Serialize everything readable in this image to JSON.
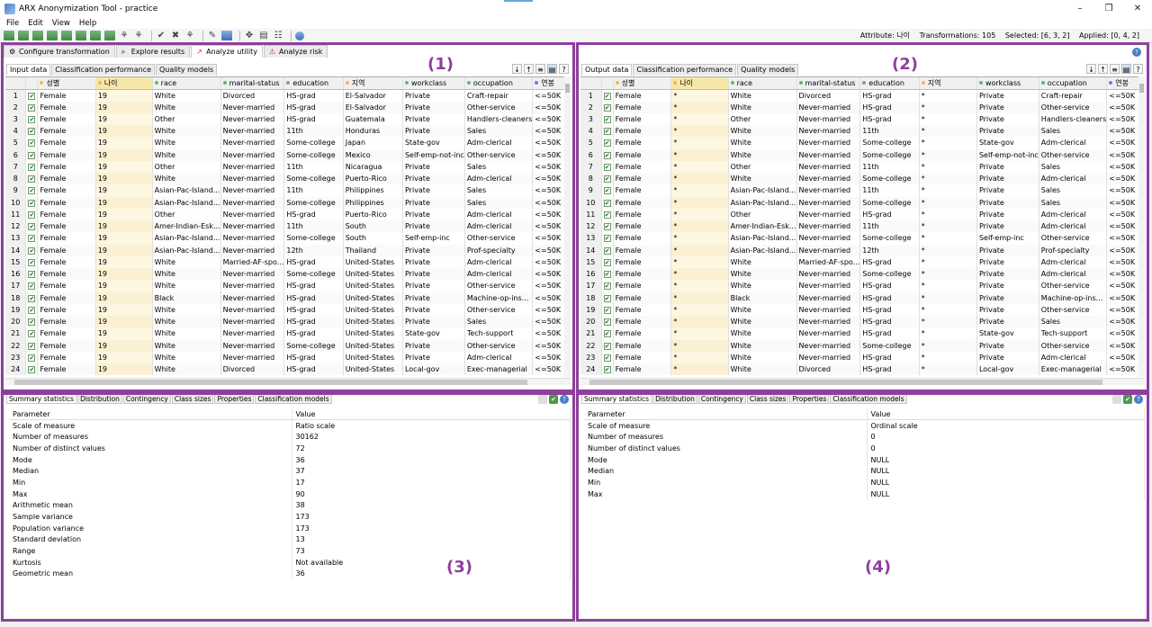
{
  "window": {
    "title": "ARX Anonymization Tool - practice",
    "controls": [
      "–",
      "❐",
      "✕"
    ]
  },
  "menu": [
    "File",
    "Edit",
    "View",
    "Help"
  ],
  "status": {
    "attribute": "Attribute: 나이",
    "transformations": "Transformations: 105",
    "selected": "Selected: [6, 3, 2]",
    "applied": "Applied: [0, 4, 2]"
  },
  "perspectives": [
    {
      "label": "Configure transformation",
      "icon": "⚙"
    },
    {
      "label": "Explore results",
      "icon": "⌕"
    },
    {
      "label": "Analyze utility",
      "icon": "↗"
    },
    {
      "label": "Analyze risk",
      "icon": "⚠"
    }
  ],
  "labels": {
    "p1": "(1)",
    "p2": "(2)",
    "p3": "(3)",
    "p4": "(4)"
  },
  "inputTabs": [
    "Input data",
    "Classification performance",
    "Quality models"
  ],
  "outputTabs": [
    "Output data",
    "Classification performance",
    "Quality models"
  ],
  "gridTools": [
    "↓",
    "↑",
    "≡",
    "▤",
    "?"
  ],
  "statTabs": [
    "Summary statistics",
    "Distribution",
    "Contingency",
    "Class sizes",
    "Properties",
    "Classification models"
  ],
  "columns": [
    "성별",
    "나이",
    "race",
    "marital-status",
    "education",
    "지역",
    "workclass",
    "occupation",
    "연봉"
  ],
  "colDots": [
    "#e8c040",
    "#e8c040",
    "#6ab36a",
    "#6ab36a",
    "#6ab36a",
    "#e8c040",
    "#6ab36a",
    "#6ab36a",
    "#9a6ac8"
  ],
  "rowNumbers": [
    "1",
    "2",
    "3",
    "4",
    "5",
    "6",
    "7",
    "8",
    "9",
    "10",
    "11",
    "12",
    "13",
    "14",
    "15",
    "16",
    "17",
    "18",
    "19",
    "20",
    "21",
    "22",
    "23",
    "24"
  ],
  "inputRows": [
    [
      "Female",
      "19",
      "White",
      "Divorced",
      "HS-grad",
      "El-Salvador",
      "Private",
      "Craft-repair",
      "<=50K"
    ],
    [
      "Female",
      "19",
      "White",
      "Never-married",
      "HS-grad",
      "El-Salvador",
      "Private",
      "Other-service",
      "<=50K"
    ],
    [
      "Female",
      "19",
      "Other",
      "Never-married",
      "HS-grad",
      "Guatemala",
      "Private",
      "Handlers-cleaners",
      "<=50K"
    ],
    [
      "Female",
      "19",
      "White",
      "Never-married",
      "11th",
      "Honduras",
      "Private",
      "Sales",
      "<=50K"
    ],
    [
      "Female",
      "19",
      "White",
      "Never-married",
      "Some-college",
      "Japan",
      "State-gov",
      "Adm-clerical",
      "<=50K"
    ],
    [
      "Female",
      "19",
      "White",
      "Never-married",
      "Some-college",
      "Mexico",
      "Self-emp-not-inc",
      "Other-service",
      "<=50K"
    ],
    [
      "Female",
      "19",
      "Other",
      "Never-married",
      "11th",
      "Nicaragua",
      "Private",
      "Sales",
      "<=50K"
    ],
    [
      "Female",
      "19",
      "White",
      "Never-married",
      "Some-college",
      "Puerto-Rico",
      "Private",
      "Adm-clerical",
      "<=50K"
    ],
    [
      "Female",
      "19",
      "Asian-Pac-Island...",
      "Never-married",
      "11th",
      "Philippines",
      "Private",
      "Sales",
      "<=50K"
    ],
    [
      "Female",
      "19",
      "Asian-Pac-Island...",
      "Never-married",
      "Some-college",
      "Philippines",
      "Private",
      "Sales",
      "<=50K"
    ],
    [
      "Female",
      "19",
      "Other",
      "Never-married",
      "HS-grad",
      "Puerto-Rico",
      "Private",
      "Adm-clerical",
      "<=50K"
    ],
    [
      "Female",
      "19",
      "Amer-Indian-Esk...",
      "Never-married",
      "11th",
      "South",
      "Private",
      "Adm-clerical",
      "<=50K"
    ],
    [
      "Female",
      "19",
      "Asian-Pac-Island...",
      "Never-married",
      "Some-college",
      "South",
      "Self-emp-inc",
      "Other-service",
      "<=50K"
    ],
    [
      "Female",
      "19",
      "Asian-Pac-Island...",
      "Never-married",
      "12th",
      "Thailand",
      "Private",
      "Prof-specialty",
      "<=50K"
    ],
    [
      "Female",
      "19",
      "White",
      "Married-AF-spo...",
      "HS-grad",
      "United-States",
      "Private",
      "Adm-clerical",
      "<=50K"
    ],
    [
      "Female",
      "19",
      "White",
      "Never-married",
      "Some-college",
      "United-States",
      "Private",
      "Adm-clerical",
      "<=50K"
    ],
    [
      "Female",
      "19",
      "White",
      "Never-married",
      "HS-grad",
      "United-States",
      "Private",
      "Other-service",
      "<=50K"
    ],
    [
      "Female",
      "19",
      "Black",
      "Never-married",
      "HS-grad",
      "United-States",
      "Private",
      "Machine-op-ins...",
      "<=50K"
    ],
    [
      "Female",
      "19",
      "White",
      "Never-married",
      "HS-grad",
      "United-States",
      "Private",
      "Other-service",
      "<=50K"
    ],
    [
      "Female",
      "19",
      "White",
      "Never-married",
      "HS-grad",
      "United-States",
      "Private",
      "Sales",
      "<=50K"
    ],
    [
      "Female",
      "19",
      "White",
      "Never-married",
      "HS-grad",
      "United-States",
      "State-gov",
      "Tech-support",
      "<=50K"
    ],
    [
      "Female",
      "19",
      "White",
      "Never-married",
      "Some-college",
      "United-States",
      "Private",
      "Other-service",
      "<=50K"
    ],
    [
      "Female",
      "19",
      "White",
      "Never-married",
      "HS-grad",
      "United-States",
      "Private",
      "Adm-clerical",
      "<=50K"
    ],
    [
      "Female",
      "19",
      "White",
      "Divorced",
      "HS-grad",
      "United-States",
      "Local-gov",
      "Exec-managerial",
      "<=50K"
    ]
  ],
  "outputRows": [
    [
      "Female",
      "*",
      "White",
      "Divorced",
      "HS-grad",
      "*",
      "Private",
      "Craft-repair",
      "<=50K"
    ],
    [
      "Female",
      "*",
      "White",
      "Never-married",
      "HS-grad",
      "*",
      "Private",
      "Other-service",
      "<=50K"
    ],
    [
      "Female",
      "*",
      "Other",
      "Never-married",
      "HS-grad",
      "*",
      "Private",
      "Handlers-cleaners",
      "<=50K"
    ],
    [
      "Female",
      "*",
      "White",
      "Never-married",
      "11th",
      "*",
      "Private",
      "Sales",
      "<=50K"
    ],
    [
      "Female",
      "*",
      "White",
      "Never-married",
      "Some-college",
      "*",
      "State-gov",
      "Adm-clerical",
      "<=50K"
    ],
    [
      "Female",
      "*",
      "White",
      "Never-married",
      "Some-college",
      "*",
      "Self-emp-not-inc",
      "Other-service",
      "<=50K"
    ],
    [
      "Female",
      "*",
      "Other",
      "Never-married",
      "11th",
      "*",
      "Private",
      "Sales",
      "<=50K"
    ],
    [
      "Female",
      "*",
      "White",
      "Never-married",
      "Some-college",
      "*",
      "Private",
      "Adm-clerical",
      "<=50K"
    ],
    [
      "Female",
      "*",
      "Asian-Pac-Island...",
      "Never-married",
      "11th",
      "*",
      "Private",
      "Sales",
      "<=50K"
    ],
    [
      "Female",
      "*",
      "Asian-Pac-Island...",
      "Never-married",
      "Some-college",
      "*",
      "Private",
      "Sales",
      "<=50K"
    ],
    [
      "Female",
      "*",
      "Other",
      "Never-married",
      "HS-grad",
      "*",
      "Private",
      "Adm-clerical",
      "<=50K"
    ],
    [
      "Female",
      "*",
      "Amer-Indian-Esk...",
      "Never-married",
      "11th",
      "*",
      "Private",
      "Adm-clerical",
      "<=50K"
    ],
    [
      "Female",
      "*",
      "Asian-Pac-Island...",
      "Never-married",
      "Some-college",
      "*",
      "Self-emp-inc",
      "Other-service",
      "<=50K"
    ],
    [
      "Female",
      "*",
      "Asian-Pac-Island...",
      "Never-married",
      "12th",
      "*",
      "Private",
      "Prof-specialty",
      "<=50K"
    ],
    [
      "Female",
      "*",
      "White",
      "Married-AF-spo...",
      "HS-grad",
      "*",
      "Private",
      "Adm-clerical",
      "<=50K"
    ],
    [
      "Female",
      "*",
      "White",
      "Never-married",
      "Some-college",
      "*",
      "Private",
      "Adm-clerical",
      "<=50K"
    ],
    [
      "Female",
      "*",
      "White",
      "Never-married",
      "HS-grad",
      "*",
      "Private",
      "Other-service",
      "<=50K"
    ],
    [
      "Female",
      "*",
      "Black",
      "Never-married",
      "HS-grad",
      "*",
      "Private",
      "Machine-op-ins...",
      "<=50K"
    ],
    [
      "Female",
      "*",
      "White",
      "Never-married",
      "HS-grad",
      "*",
      "Private",
      "Other-service",
      "<=50K"
    ],
    [
      "Female",
      "*",
      "White",
      "Never-married",
      "HS-grad",
      "*",
      "Private",
      "Sales",
      "<=50K"
    ],
    [
      "Female",
      "*",
      "White",
      "Never-married",
      "HS-grad",
      "*",
      "State-gov",
      "Tech-support",
      "<=50K"
    ],
    [
      "Female",
      "*",
      "White",
      "Never-married",
      "Some-college",
      "*",
      "Private",
      "Other-service",
      "<=50K"
    ],
    [
      "Female",
      "*",
      "White",
      "Never-married",
      "HS-grad",
      "*",
      "Private",
      "Adm-clerical",
      "<=50K"
    ],
    [
      "Female",
      "*",
      "White",
      "Divorced",
      "HS-grad",
      "*",
      "Local-gov",
      "Exec-managerial",
      "<=50K"
    ]
  ],
  "statsHeader": [
    "Parameter",
    "Value"
  ],
  "inputStats": [
    [
      "Scale of measure",
      "Ratio scale"
    ],
    [
      "Number of measures",
      "30162"
    ],
    [
      "Number of distinct values",
      "72"
    ],
    [
      "Mode",
      "36"
    ],
    [
      "Median",
      "37"
    ],
    [
      "Min",
      "17"
    ],
    [
      "Max",
      "90"
    ],
    [
      "Arithmetic mean",
      "38"
    ],
    [
      "Sample variance",
      "173"
    ],
    [
      "Population variance",
      "173"
    ],
    [
      "Standard deviation",
      "13"
    ],
    [
      "Range",
      "73"
    ],
    [
      "Kurtosis",
      "Not available"
    ],
    [
      "Geometric mean",
      "36"
    ]
  ],
  "outputStats": [
    [
      "Scale of measure",
      "Ordinal scale"
    ],
    [
      "Number of measures",
      "0"
    ],
    [
      "Number of distinct values",
      "0"
    ],
    [
      "Mode",
      "NULL"
    ],
    [
      "Median",
      "NULL"
    ],
    [
      "Min",
      "NULL"
    ],
    [
      "Max",
      "NULL"
    ]
  ]
}
